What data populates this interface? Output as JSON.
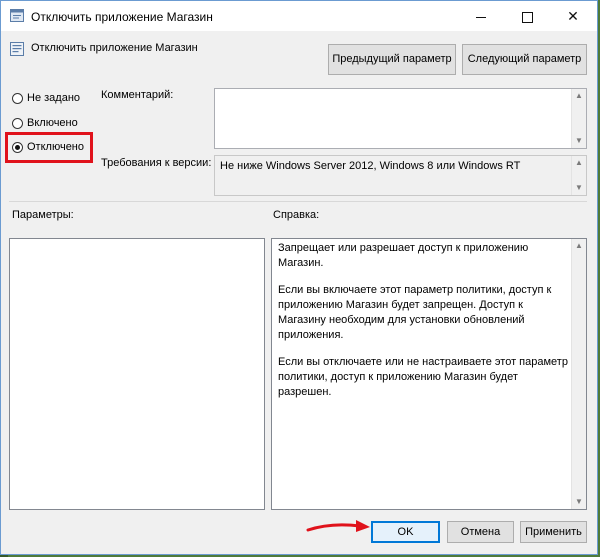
{
  "window": {
    "title": "Отключить приложение Магазин",
    "caption_close": "✕"
  },
  "header": {
    "policy_name": "Отключить приложение Магазин",
    "prev_button": "Предыдущий параметр",
    "next_button": "Следующий параметр"
  },
  "state": {
    "options": [
      {
        "label": "Не задано",
        "checked": false
      },
      {
        "label": "Включено",
        "checked": false
      },
      {
        "label": "Отключено",
        "checked": true
      }
    ]
  },
  "comment": {
    "label": "Комментарий:",
    "value": ""
  },
  "requirements": {
    "label": "Требования к версии:",
    "value": "Не ниже Windows Server 2012, Windows 8 или Windows RT"
  },
  "options_panel": {
    "label": "Параметры:"
  },
  "help_panel": {
    "label": "Справка:",
    "paragraphs": [
      "Запрещает или разрешает доступ к приложению Магазин.",
      "Если вы включаете этот параметр политики, доступ к приложению Магазин будет запрещен. Доступ к Магазину необходим для установки обновлений приложения.",
      "Если вы отключаете или не настраиваете этот параметр политики, доступ к приложению Магазин будет разрешен."
    ]
  },
  "footer": {
    "ok": "OK",
    "cancel": "Отмена",
    "apply": "Применить"
  },
  "colors": {
    "highlight": "#e0121b",
    "window_border": "#6b9bd1",
    "default_button_border": "#0078d7"
  }
}
